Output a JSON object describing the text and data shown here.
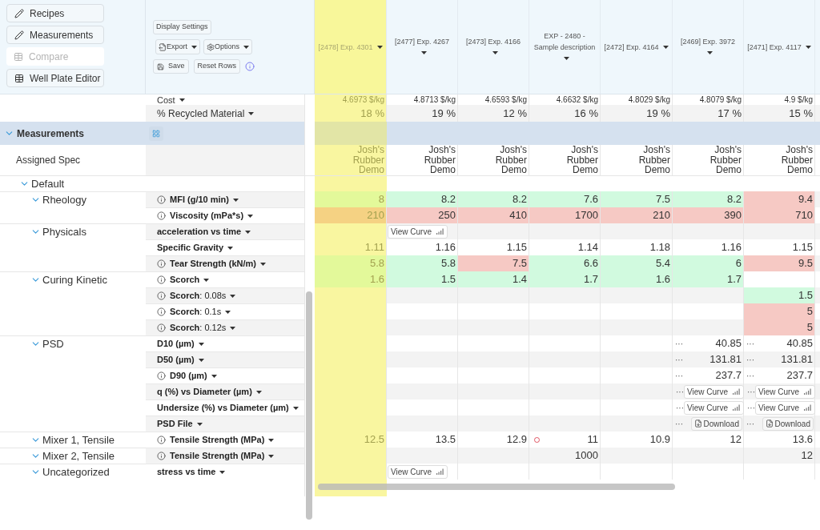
{
  "nav": [
    {
      "label": "Recipes",
      "kind": "edit",
      "disabled": false
    },
    {
      "label": "Measurements",
      "kind": "edit",
      "disabled": false
    },
    {
      "label": "Compare",
      "kind": "table",
      "disabled": true
    },
    {
      "label": "Well Plate Editor",
      "kind": "table",
      "disabled": false
    }
  ],
  "toolbar": {
    "display_settings": "Display Settings",
    "export": "Export",
    "options": "Options",
    "save": "Save",
    "reset_rows": "Reset Rows"
  },
  "columns": [
    {
      "label": "[2478] Exp. 4301",
      "selected": true
    },
    {
      "label": "[2477] Exp. 4267",
      "selected": false
    },
    {
      "label": "[2473] Exp. 4166",
      "selected": false
    },
    {
      "label": "EXP - 2480 - Sample description",
      "selected": false
    },
    {
      "label": "[2472] Exp. 4164",
      "selected": false
    },
    {
      "label": "[2469] Exp. 3972",
      "selected": false
    },
    {
      "label": "[2471] Exp. 4117",
      "selected": false
    }
  ],
  "summary_rows": [
    {
      "label": "Cost",
      "values": [
        "4.6973 $/kg",
        "4.8713 $/kg",
        "4.6593 $/kg",
        "4.6632 $/kg",
        "4.8029 $/kg",
        "4.8079 $/kg",
        "4.9 $/kg"
      ]
    },
    {
      "label": "% Recycled Material",
      "values": [
        "18 %",
        "19 %",
        "12 %",
        "16 %",
        "19 %",
        "17 %",
        "15 %"
      ]
    }
  ],
  "section": {
    "title": "Measurements",
    "expanded": true
  },
  "spec": {
    "label": "Assigned Spec",
    "values": [
      "Josh's Rubber Demo",
      "Josh's Rubber Demo",
      "Josh's Rubber Demo",
      "Josh's Rubber Demo",
      "Josh's Rubber Demo",
      "Josh's Rubber Demo",
      "Josh's Rubber Demo"
    ]
  },
  "groups": [
    {
      "name": "Default",
      "expanded": true,
      "children": [
        {
          "name": "Rheology",
          "expanded": true,
          "rows": [
            {
              "label": "MFI (g/10 min)",
              "info": true,
              "cells": [
                {
                  "kind": "value",
                  "text": "8",
                  "pass": true
                },
                {
                  "kind": "value",
                  "text": "8.2",
                  "pass": true
                },
                {
                  "kind": "value",
                  "text": "8.2",
                  "pass": true
                },
                {
                  "kind": "value",
                  "text": "7.6",
                  "pass": true
                },
                {
                  "kind": "value",
                  "text": "7.5",
                  "pass": true
                },
                {
                  "kind": "value",
                  "text": "8.2",
                  "pass": true
                },
                {
                  "kind": "value",
                  "text": "9.4",
                  "pass": false
                }
              ]
            },
            {
              "label": "Viscosity (mPa*s)",
              "info": true,
              "cells": [
                {
                  "kind": "value",
                  "text": "210",
                  "pass": false
                },
                {
                  "kind": "value",
                  "text": "250",
                  "pass": false
                },
                {
                  "kind": "value",
                  "text": "410",
                  "pass": false
                },
                {
                  "kind": "value",
                  "text": "1700",
                  "pass": false
                },
                {
                  "kind": "value",
                  "text": "210",
                  "pass": false
                },
                {
                  "kind": "value",
                  "text": "390",
                  "pass": false
                },
                {
                  "kind": "value",
                  "text": "710",
                  "pass": false
                }
              ]
            }
          ]
        },
        {
          "name": "Physicals",
          "expanded": true,
          "rows": [
            {
              "label": "acceleration vs time",
              "info": false,
              "cells": [
                {
                  "kind": "empty"
                },
                {
                  "kind": "curve",
                  "text": "View Curve"
                },
                {
                  "kind": "empty"
                },
                {
                  "kind": "empty"
                },
                {
                  "kind": "empty"
                },
                {
                  "kind": "empty"
                },
                {
                  "kind": "empty"
                }
              ]
            },
            {
              "label": "Specific Gravity",
              "info": false,
              "cells": [
                {
                  "kind": "value",
                  "text": "1.11"
                },
                {
                  "kind": "value",
                  "text": "1.16"
                },
                {
                  "kind": "value",
                  "text": "1.15"
                },
                {
                  "kind": "value",
                  "text": "1.14"
                },
                {
                  "kind": "value",
                  "text": "1.18"
                },
                {
                  "kind": "value",
                  "text": "1.16"
                },
                {
                  "kind": "value",
                  "text": "1.15"
                }
              ]
            },
            {
              "label": "Tear Strength (kN/m)",
              "info": true,
              "cells": [
                {
                  "kind": "value",
                  "text": "5.8",
                  "pass": true
                },
                {
                  "kind": "value",
                  "text": "5.8",
                  "pass": true
                },
                {
                  "kind": "value",
                  "text": "7.5",
                  "pass": false
                },
                {
                  "kind": "value",
                  "text": "6.6",
                  "pass": true
                },
                {
                  "kind": "value",
                  "text": "5.4",
                  "pass": true
                },
                {
                  "kind": "value",
                  "text": "6",
                  "pass": true
                },
                {
                  "kind": "value",
                  "text": "9.5",
                  "pass": false
                }
              ]
            }
          ]
        },
        {
          "name": "Curing Kinetic",
          "expanded": true,
          "rows": [
            {
              "label": "Scorch",
              "info": true,
              "cells": [
                {
                  "kind": "value",
                  "text": "1.6",
                  "pass": true
                },
                {
                  "kind": "value",
                  "text": "1.5",
                  "pass": true
                },
                {
                  "kind": "value",
                  "text": "1.4",
                  "pass": true
                },
                {
                  "kind": "value",
                  "text": "1.7",
                  "pass": true
                },
                {
                  "kind": "value",
                  "text": "1.6",
                  "pass": true
                },
                {
                  "kind": "value",
                  "text": "1.7",
                  "pass": true
                },
                {
                  "kind": "empty"
                }
              ]
            },
            {
              "label": "Scorch",
              "detail": ": 0.08s",
              "info": true,
              "cells": [
                {
                  "kind": "empty"
                },
                {
                  "kind": "empty"
                },
                {
                  "kind": "empty"
                },
                {
                  "kind": "empty"
                },
                {
                  "kind": "empty"
                },
                {
                  "kind": "empty"
                },
                {
                  "kind": "value",
                  "text": "1.5",
                  "pass": true
                }
              ]
            },
            {
              "label": "Scorch",
              "detail": ": 0.1s",
              "info": true,
              "cells": [
                {
                  "kind": "empty"
                },
                {
                  "kind": "empty"
                },
                {
                  "kind": "empty"
                },
                {
                  "kind": "empty"
                },
                {
                  "kind": "empty"
                },
                {
                  "kind": "empty"
                },
                {
                  "kind": "value",
                  "text": "5",
                  "pass": false
                }
              ]
            },
            {
              "label": "Scorch",
              "detail": ": 0.12s",
              "info": true,
              "cells": [
                {
                  "kind": "empty"
                },
                {
                  "kind": "empty"
                },
                {
                  "kind": "empty"
                },
                {
                  "kind": "empty"
                },
                {
                  "kind": "empty"
                },
                {
                  "kind": "empty"
                },
                {
                  "kind": "value",
                  "text": "5",
                  "pass": false
                }
              ]
            }
          ]
        },
        {
          "name": "PSD",
          "expanded": true,
          "rows": [
            {
              "label": "D10 (µm)",
              "info": false,
              "cells": [
                {
                  "kind": "empty"
                },
                {
                  "kind": "empty"
                },
                {
                  "kind": "empty"
                },
                {
                  "kind": "empty"
                },
                {
                  "kind": "empty"
                },
                {
                  "kind": "value",
                  "text": "40.85",
                  "more": "···"
                },
                {
                  "kind": "value",
                  "text": "40.85",
                  "more": "···"
                }
              ]
            },
            {
              "label": "D50 (µm)",
              "info": false,
              "cells": [
                {
                  "kind": "empty"
                },
                {
                  "kind": "empty"
                },
                {
                  "kind": "empty"
                },
                {
                  "kind": "empty"
                },
                {
                  "kind": "empty"
                },
                {
                  "kind": "value",
                  "text": "131.81",
                  "more": "···"
                },
                {
                  "kind": "value",
                  "text": "131.81",
                  "more": "···"
                }
              ]
            },
            {
              "label": "D90 (µm)",
              "info": true,
              "cells": [
                {
                  "kind": "empty"
                },
                {
                  "kind": "empty"
                },
                {
                  "kind": "empty"
                },
                {
                  "kind": "empty"
                },
                {
                  "kind": "empty"
                },
                {
                  "kind": "value",
                  "text": "237.7",
                  "more": "···"
                },
                {
                  "kind": "value",
                  "text": "237.7",
                  "more": "···"
                }
              ]
            },
            {
              "label": "q (%) vs Diameter (µm)",
              "info": false,
              "cells": [
                {
                  "kind": "empty"
                },
                {
                  "kind": "empty"
                },
                {
                  "kind": "empty"
                },
                {
                  "kind": "empty"
                },
                {
                  "kind": "empty"
                },
                {
                  "kind": "curve",
                  "text": "View Curve",
                  "more": "···"
                },
                {
                  "kind": "curve",
                  "text": "View Curve",
                  "more": "···"
                }
              ]
            },
            {
              "label": "Undersize (%) vs Diameter (µm)",
              "info": false,
              "cells": [
                {
                  "kind": "empty"
                },
                {
                  "kind": "empty"
                },
                {
                  "kind": "empty"
                },
                {
                  "kind": "empty"
                },
                {
                  "kind": "empty"
                },
                {
                  "kind": "curve",
                  "text": "View Curve",
                  "more": "···"
                },
                {
                  "kind": "curve",
                  "text": "View Curve",
                  "more": "···"
                }
              ]
            },
            {
              "label": "PSD File",
              "info": false,
              "cells": [
                {
                  "kind": "empty"
                },
                {
                  "kind": "empty"
                },
                {
                  "kind": "empty"
                },
                {
                  "kind": "empty"
                },
                {
                  "kind": "empty"
                },
                {
                  "kind": "download",
                  "text": "Download",
                  "more": "···"
                },
                {
                  "kind": "download",
                  "text": "Download",
                  "more": "···"
                }
              ]
            }
          ]
        },
        {
          "name": "Mixer 1, Tensile",
          "expanded": true,
          "rows": [
            {
              "label": "Tensile Strength (MPa)",
              "info": true,
              "cells": [
                {
                  "kind": "value",
                  "text": "12.5"
                },
                {
                  "kind": "value",
                  "text": "13.5"
                },
                {
                  "kind": "value",
                  "text": "12.9"
                },
                {
                  "kind": "value",
                  "text": "11",
                  "flag": true
                },
                {
                  "kind": "value",
                  "text": "10.9"
                },
                {
                  "kind": "value",
                  "text": "12"
                },
                {
                  "kind": "value",
                  "text": "13.6"
                }
              ]
            }
          ]
        },
        {
          "name": "Mixer 2, Tensile",
          "expanded": true,
          "rows": [
            {
              "label": "Tensile Strength (MPa)",
              "info": true,
              "cells": [
                {
                  "kind": "empty"
                },
                {
                  "kind": "empty"
                },
                {
                  "kind": "empty"
                },
                {
                  "kind": "value",
                  "text": "1000"
                },
                {
                  "kind": "empty"
                },
                {
                  "kind": "empty"
                },
                {
                  "kind": "value",
                  "text": "12"
                }
              ]
            }
          ]
        },
        {
          "name": "Uncategorized",
          "expanded": true,
          "rows": [
            {
              "label": "stress vs time",
              "info": false,
              "cells": [
                {
                  "kind": "empty"
                },
                {
                  "kind": "curve",
                  "text": "View Curve"
                },
                {
                  "kind": "empty"
                },
                {
                  "kind": "empty"
                },
                {
                  "kind": "empty"
                },
                {
                  "kind": "empty"
                },
                {
                  "kind": "empty"
                }
              ]
            }
          ]
        }
      ]
    }
  ]
}
